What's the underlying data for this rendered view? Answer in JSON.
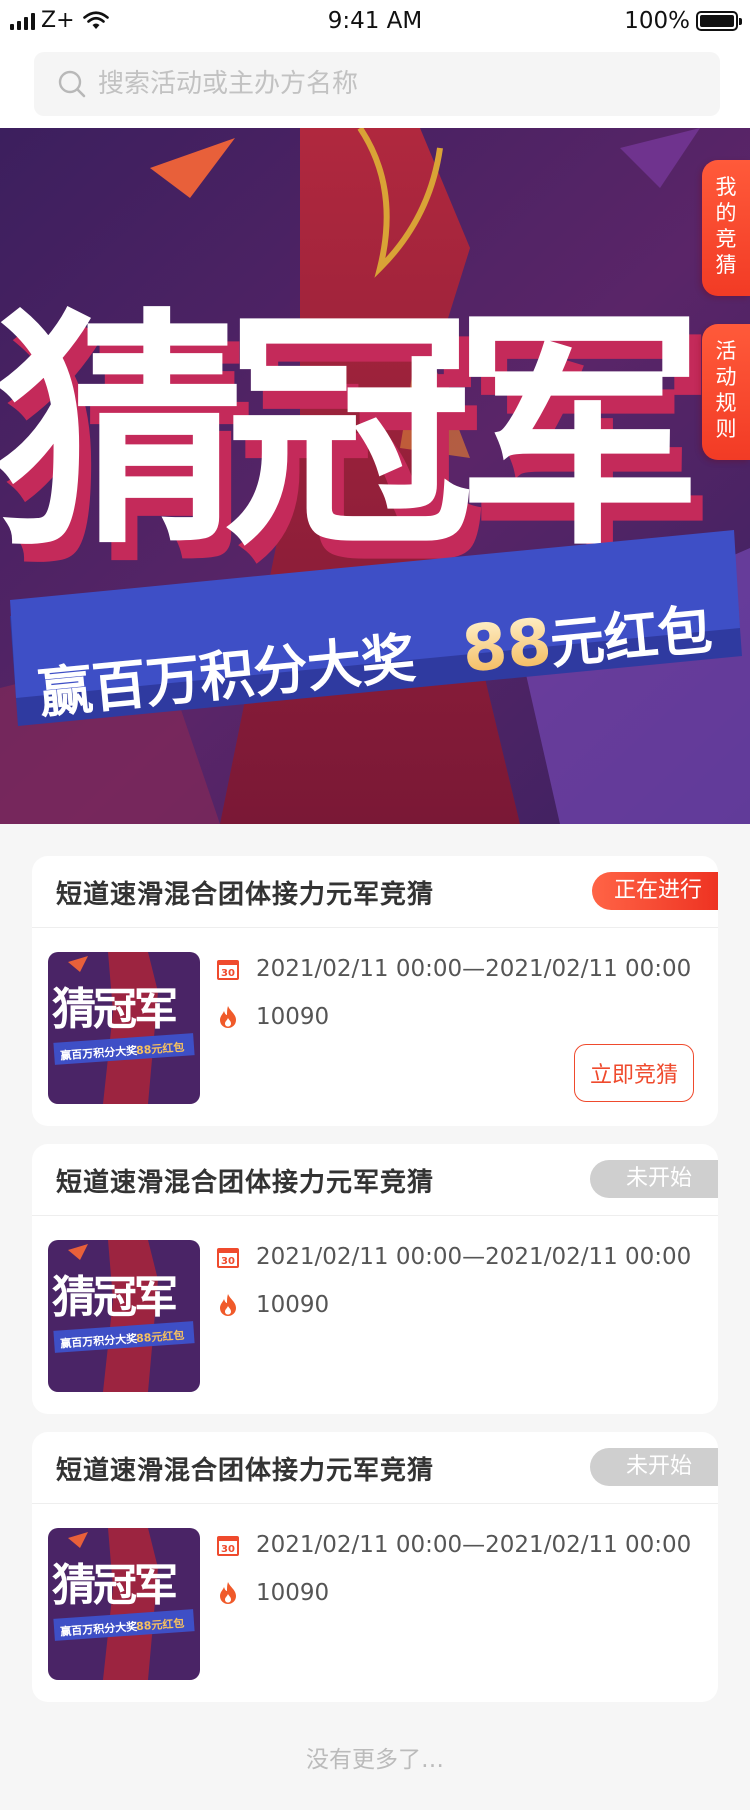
{
  "status_bar": {
    "carrier": "Z+",
    "time": "9:41 AM",
    "battery": "100%",
    "battery_level": 1.0
  },
  "search": {
    "placeholder": "搜索活动或主办方名称"
  },
  "banner": {
    "headline": "猜冠军",
    "subline": "赢百万积分大奖",
    "prize_number": "88",
    "prize_text": "元红包",
    "side_tabs": [
      "我的竞猜",
      "活动规则"
    ]
  },
  "cards": [
    {
      "title": "短道速滑混合团体接力元军竞猜",
      "status": "正在进行",
      "date_range": "2021/02/11 00:00—2021/02/11 00:00",
      "participants": "10090",
      "action_label": "立即竞猜",
      "thumb_headline": "猜冠军",
      "thumb_subline": "赢百万积分大奖",
      "thumb_prize": "88元红包"
    },
    {
      "title": "短道速滑混合团体接力元军竞猜",
      "status": "未开始",
      "date_range": "2021/02/11 00:00—2021/02/11 00:00",
      "participants": "10090",
      "thumb_headline": "猜冠军",
      "thumb_subline": "赢百万积分大奖",
      "thumb_prize": "88元红包"
    },
    {
      "title": "短道速滑混合团体接力元军竞猜",
      "status": "未开始",
      "date_range": "2021/02/11 00:00—2021/02/11 00:00",
      "participants": "10090",
      "thumb_headline": "猜冠军",
      "thumb_subline": "赢百万积分大奖",
      "thumb_prize": "88元红包"
    }
  ],
  "footer": {
    "no_more": "没有更多了…"
  },
  "colors": {
    "accent": "#ef4a2d",
    "pending": "#cfcfcf",
    "banner_purple": "#4a2466",
    "banner_blue": "#3e4fc6"
  },
  "icons": {
    "calendar": "calendar-icon",
    "hot": "flame-icon",
    "search": "search-icon"
  }
}
